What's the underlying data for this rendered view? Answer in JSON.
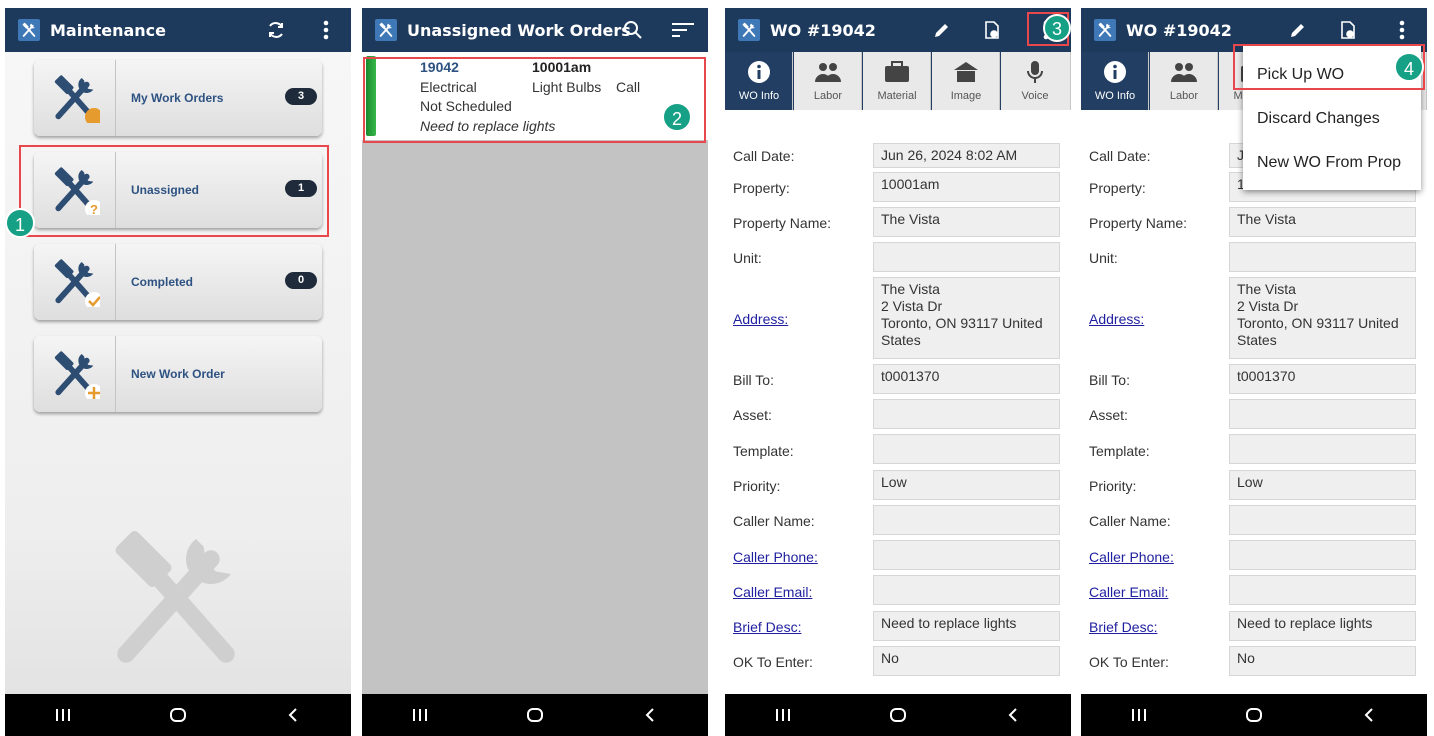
{
  "panel1": {
    "title": "Maintenance",
    "menu": [
      {
        "label": "My Work Orders",
        "count": "3"
      },
      {
        "label": "Unassigned",
        "count": "1"
      },
      {
        "label": "Completed",
        "count": "0"
      },
      {
        "label": "New Work Order"
      }
    ],
    "step": "1"
  },
  "panel2": {
    "title": "Unassigned Work Orders",
    "work_order": {
      "number": "19042",
      "property": "10001am",
      "category": "Electrical",
      "subcategory": "Light Bulbs",
      "source": "Call",
      "schedule": "Not Scheduled",
      "description": "Need to replace lights"
    },
    "step": "2"
  },
  "panel3": {
    "title": "WO #19042",
    "step": "3"
  },
  "panel4": {
    "title": "WO #19042",
    "step": "4",
    "menu": [
      "Pick Up WO",
      "Discard Changes",
      "New WO From Prop"
    ]
  },
  "tabs": [
    "WO Info",
    "Labor",
    "Material",
    "Image",
    "Voice"
  ],
  "form": {
    "call_date_label": "Call Date:",
    "call_date": "Jun 26, 2024 8:02 AM",
    "property_label": "Property:",
    "property": "10001am",
    "property_name_label": "Property Name:",
    "property_name": "The Vista",
    "unit_label": "Unit:",
    "unit": "",
    "address_label": "Address:",
    "address": "The Vista\n2 Vista Dr\nToronto, ON 93117 United States",
    "bill_to_label": "Bill To:",
    "bill_to": "t0001370",
    "asset_label": "Asset:",
    "asset": "",
    "template_label": "Template:",
    "template": "",
    "priority_label": "Priority:",
    "priority": "Low",
    "caller_name_label": "Caller Name:",
    "caller_name": "",
    "caller_phone_label": "Caller Phone:",
    "caller_phone": "",
    "caller_email_label": "Caller Email:",
    "caller_email": "",
    "brief_desc_label": "Brief Desc:",
    "brief_desc": "Need to replace lights",
    "ok_to_enter_label": "OK To Enter:",
    "ok_to_enter": "No"
  },
  "colors": {
    "header": "#1d3a5d",
    "badge": "#1f2b3a",
    "step": "#16a085",
    "highlight": "#e8484c",
    "link": "#1f1fa0"
  },
  "icons": [
    "app-logo-icon",
    "refresh-icon",
    "more-vert-icon",
    "search-icon",
    "sort-icon",
    "edit-icon",
    "save-doc-icon",
    "info-icon",
    "labor-icon",
    "material-icon",
    "image-icon",
    "voice-icon",
    "recents-icon",
    "home-icon",
    "back-icon"
  ]
}
